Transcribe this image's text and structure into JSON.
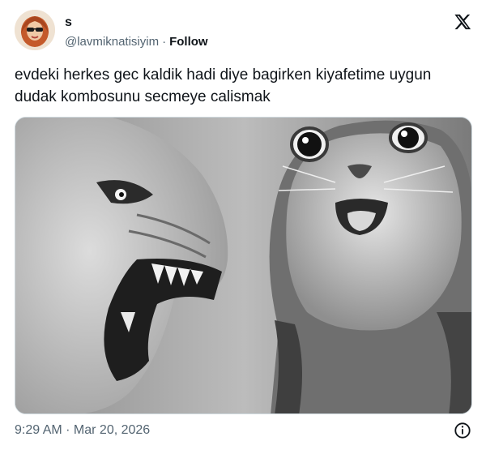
{
  "tweet": {
    "author": {
      "display_name": "s",
      "handle": "@lavmiknatisiyim",
      "separator": "·",
      "follow_label": "Follow"
    },
    "text": "evdeki herkes gec kaldik hadi diye bagirken kiyafetime uygun dudak kombosunu secmeye calismak",
    "timestamp": "9:29 AM · Mar 20, 2026",
    "icons": {
      "platform": "x-logo-icon",
      "info": "info-icon"
    }
  }
}
